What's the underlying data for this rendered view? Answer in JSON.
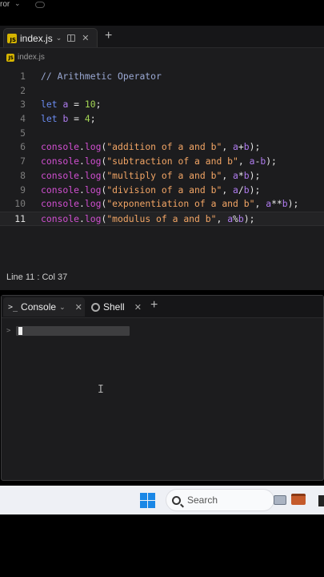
{
  "top_strip": {
    "fragment": "ror",
    "chevron": "⌄"
  },
  "editor": {
    "tab": {
      "filename": "index.js"
    },
    "breadcrumb": "index.js",
    "lines": [
      {
        "n": "1",
        "tokens": [
          {
            "t": "// Arithmetic Operator",
            "c": "comment"
          }
        ]
      },
      {
        "n": "2",
        "tokens": []
      },
      {
        "n": "3",
        "tokens": [
          {
            "t": "let",
            "c": "kw"
          },
          {
            "t": " ",
            "c": "plain"
          },
          {
            "t": "a",
            "c": "var"
          },
          {
            "t": " = ",
            "c": "plain"
          },
          {
            "t": "10",
            "c": "num"
          },
          {
            "t": ";",
            "c": "plain"
          }
        ]
      },
      {
        "n": "4",
        "tokens": [
          {
            "t": "let",
            "c": "kw"
          },
          {
            "t": " ",
            "c": "plain"
          },
          {
            "t": "b",
            "c": "var"
          },
          {
            "t": " = ",
            "c": "plain"
          },
          {
            "t": "4",
            "c": "num"
          },
          {
            "t": ";",
            "c": "plain"
          }
        ]
      },
      {
        "n": "5",
        "tokens": []
      },
      {
        "n": "6",
        "tokens": [
          {
            "t": "console",
            "c": "obj"
          },
          {
            "t": ".",
            "c": "plain"
          },
          {
            "t": "log",
            "c": "obj"
          },
          {
            "t": "(",
            "c": "plain"
          },
          {
            "t": "\"addition of a and b\"",
            "c": "str"
          },
          {
            "t": ", ",
            "c": "plain"
          },
          {
            "t": "a",
            "c": "var"
          },
          {
            "t": "+",
            "c": "plain"
          },
          {
            "t": "b",
            "c": "var"
          },
          {
            "t": ");",
            "c": "plain"
          }
        ]
      },
      {
        "n": "7",
        "tokens": [
          {
            "t": "console",
            "c": "obj"
          },
          {
            "t": ".",
            "c": "plain"
          },
          {
            "t": "log",
            "c": "obj"
          },
          {
            "t": "(",
            "c": "plain"
          },
          {
            "t": "\"subtraction of a and b\"",
            "c": "str"
          },
          {
            "t": ", ",
            "c": "plain"
          },
          {
            "t": "a",
            "c": "var"
          },
          {
            "t": "-",
            "c": "plain"
          },
          {
            "t": "b",
            "c": "var"
          },
          {
            "t": ");",
            "c": "plain"
          }
        ]
      },
      {
        "n": "8",
        "tokens": [
          {
            "t": "console",
            "c": "obj"
          },
          {
            "t": ".",
            "c": "plain"
          },
          {
            "t": "log",
            "c": "obj"
          },
          {
            "t": "(",
            "c": "plain"
          },
          {
            "t": "\"multiply of a and b\"",
            "c": "str"
          },
          {
            "t": ", ",
            "c": "plain"
          },
          {
            "t": "a",
            "c": "var"
          },
          {
            "t": "*",
            "c": "plain"
          },
          {
            "t": "b",
            "c": "var"
          },
          {
            "t": ");",
            "c": "plain"
          }
        ]
      },
      {
        "n": "9",
        "tokens": [
          {
            "t": "console",
            "c": "obj"
          },
          {
            "t": ".",
            "c": "plain"
          },
          {
            "t": "log",
            "c": "obj"
          },
          {
            "t": "(",
            "c": "plain"
          },
          {
            "t": "\"division of a and b\"",
            "c": "str"
          },
          {
            "t": ", ",
            "c": "plain"
          },
          {
            "t": "a",
            "c": "var"
          },
          {
            "t": "/",
            "c": "plain"
          },
          {
            "t": "b",
            "c": "var"
          },
          {
            "t": ");",
            "c": "plain"
          }
        ]
      },
      {
        "n": "10",
        "tokens": [
          {
            "t": "console",
            "c": "obj"
          },
          {
            "t": ".",
            "c": "plain"
          },
          {
            "t": "log",
            "c": "obj"
          },
          {
            "t": "(",
            "c": "plain"
          },
          {
            "t": "\"exponentiation of a and b\"",
            "c": "str"
          },
          {
            "t": ", ",
            "c": "plain"
          },
          {
            "t": "a",
            "c": "var"
          },
          {
            "t": "**",
            "c": "plain"
          },
          {
            "t": "b",
            "c": "var"
          },
          {
            "t": ");",
            "c": "plain"
          }
        ]
      },
      {
        "n": "11",
        "active": true,
        "tokens": [
          {
            "t": "console",
            "c": "obj"
          },
          {
            "t": ".",
            "c": "plain"
          },
          {
            "t": "log",
            "c": "obj"
          },
          {
            "t": "(",
            "c": "plain"
          },
          {
            "t": "\"modulus of a and b\"",
            "c": "str"
          },
          {
            "t": ", ",
            "c": "plain"
          },
          {
            "t": "a",
            "c": "var"
          },
          {
            "t": "%",
            "c": "plain"
          },
          {
            "t": "b",
            "c": "var"
          },
          {
            "t": ");",
            "c": "plain"
          }
        ]
      }
    ],
    "status": "Line 11 : Col 37"
  },
  "console_panel": {
    "console_tab": "Console",
    "shell_tab": "Shell",
    "prompt": ">"
  },
  "taskbar": {
    "search_placeholder": "Search"
  },
  "colors": {
    "comment": "#9aa8d3",
    "keyword": "#6a8bf0",
    "variable": "#b07cf0",
    "number": "#a4d655",
    "object": "#d04fd0",
    "string": "#f2a565",
    "windows_blue": "#1a87e6"
  },
  "icons": [
    "js-file-icon",
    "split-view-icon",
    "close-icon",
    "add-tab-icon",
    "terminal-icon",
    "shell-icon",
    "windows-start-icon",
    "search-icon",
    "folder-app-icon",
    "briefcase-app-icon"
  ]
}
